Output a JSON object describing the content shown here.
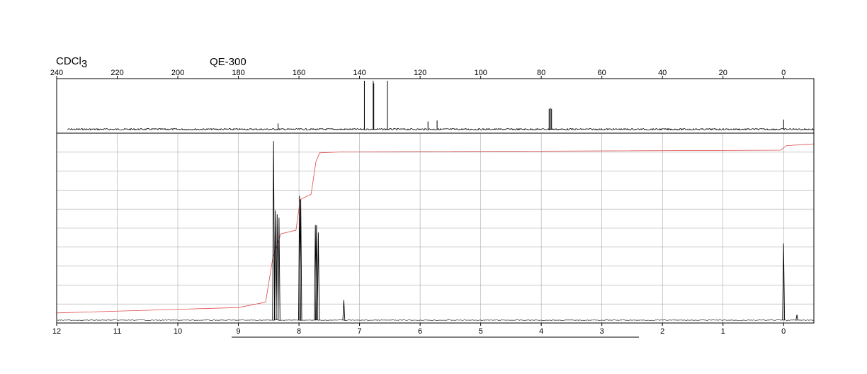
{
  "header": {
    "solvent_prefix": "CDCl",
    "solvent_subscript": "3",
    "instrument": "QE-300"
  },
  "chart_data": [
    {
      "type": "line",
      "name": "13C NMR spectrum",
      "title": "",
      "xlabel": "",
      "ylabel": "",
      "xlim": [
        240,
        -10
      ],
      "x_reversed": true,
      "x_ticks": [
        240,
        220,
        200,
        180,
        160,
        140,
        120,
        100,
        80,
        60,
        40,
        20,
        0
      ],
      "grid": false,
      "peaks": [
        {
          "x": 166.9,
          "height": 0.12
        },
        {
          "x": 138.4,
          "height": 1.0
        },
        {
          "x": 135.5,
          "height": 1.0
        },
        {
          "x": 135.3,
          "height": 0.95
        },
        {
          "x": 130.8,
          "height": 1.0
        },
        {
          "x": 117.4,
          "height": 0.16
        },
        {
          "x": 114.4,
          "height": 0.18
        },
        {
          "x": 77.4,
          "height": 0.42
        },
        {
          "x": 77.0,
          "height": 0.44
        },
        {
          "x": 76.6,
          "height": 0.42
        },
        {
          "x": 0.0,
          "height": 0.2
        }
      ]
    },
    {
      "type": "line",
      "name": "1H NMR spectrum",
      "title": "",
      "xlabel": "",
      "ylabel": "",
      "xlim": [
        12,
        -0.5
      ],
      "x_reversed": true,
      "x_ticks": [
        12,
        11,
        10,
        9,
        8,
        7,
        6,
        5,
        4,
        3,
        2,
        1,
        0
      ],
      "grid": true,
      "peaks": [
        {
          "x": 8.42,
          "height": 0.98
        },
        {
          "x": 8.39,
          "height": 0.6
        },
        {
          "x": 8.36,
          "height": 0.58
        },
        {
          "x": 8.33,
          "height": 0.56
        },
        {
          "x": 7.99,
          "height": 0.68
        },
        {
          "x": 7.97,
          "height": 0.66
        },
        {
          "x": 7.73,
          "height": 0.52
        },
        {
          "x": 7.71,
          "height": 0.52
        },
        {
          "x": 7.68,
          "height": 0.48
        },
        {
          "x": 7.26,
          "height": 0.11
        },
        {
          "x": 0.0,
          "height": 0.42
        },
        {
          "x": -0.22,
          "height": 0.03
        }
      ],
      "integral": [
        {
          "x": 12.0,
          "y": 0.04
        },
        {
          "x": 9.0,
          "y": 0.07
        },
        {
          "x": 8.55,
          "y": 0.1
        },
        {
          "x": 8.43,
          "y": 0.35
        },
        {
          "x": 8.3,
          "y": 0.48
        },
        {
          "x": 8.05,
          "y": 0.5
        },
        {
          "x": 7.98,
          "y": 0.67
        },
        {
          "x": 7.8,
          "y": 0.7
        },
        {
          "x": 7.72,
          "y": 0.88
        },
        {
          "x": 7.66,
          "y": 0.93
        },
        {
          "x": 7.3,
          "y": 0.935
        },
        {
          "x": 0.05,
          "y": 0.945
        },
        {
          "x": -0.05,
          "y": 0.97
        },
        {
          "x": -0.5,
          "y": 0.98
        }
      ]
    }
  ],
  "colors": {
    "spectrum": "#000000",
    "integral": "#e04848",
    "grid": "#a8a8a8"
  }
}
